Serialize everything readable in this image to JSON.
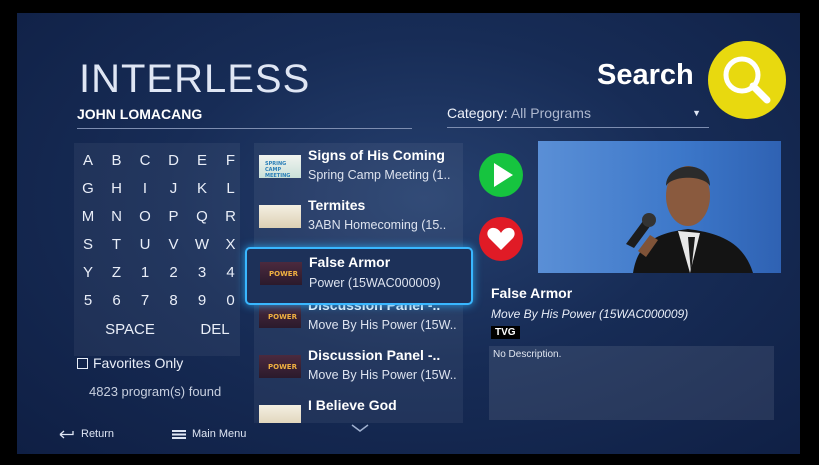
{
  "app": {
    "title": "INTERLESS"
  },
  "search": {
    "query": "JOHN LOMACANG",
    "label": "Search"
  },
  "category": {
    "label": "Category:",
    "value": "All Programs"
  },
  "keypad": {
    "rows": [
      [
        "A",
        "B",
        "C",
        "D",
        "E",
        "F"
      ],
      [
        "G",
        "H",
        "I",
        "J",
        "K",
        "L"
      ],
      [
        "M",
        "N",
        "O",
        "P",
        "Q",
        "R"
      ],
      [
        "S",
        "T",
        "U",
        "V",
        "W",
        "X"
      ],
      [
        "Y",
        "Z",
        "1",
        "2",
        "3",
        "4"
      ],
      [
        "5",
        "6",
        "7",
        "8",
        "9",
        "0"
      ]
    ],
    "space": "SPACE",
    "del": "DEL"
  },
  "filters": {
    "favorites_label": "Favorites Only",
    "found": "4823 program(s) found"
  },
  "results": [
    {
      "title": "Signs of His Coming",
      "subtitle": "Spring Camp Meeting (1..",
      "thumb": "spring-camp-meeting"
    },
    {
      "title": "Termites",
      "subtitle": "3ABN Homecoming (15..",
      "thumb": "3abn-homecoming"
    },
    {
      "title": "False Armor",
      "subtitle": "Power (15WAC000009)",
      "thumb": "move-by-his-power"
    },
    {
      "title": "Discussion Panel -..",
      "subtitle": "Move By His Power (15W..",
      "thumb": "move-by-his-power"
    },
    {
      "title": "Discussion Panel -..",
      "subtitle": "Move By His Power (15W..",
      "thumb": "move-by-his-power"
    },
    {
      "title": "I Believe God",
      "subtitle": "",
      "thumb": "3abn-homecoming"
    }
  ],
  "thumb_texts": {
    "spring": "SPRING CAMP MEETING",
    "power": "POWER"
  },
  "detail": {
    "title": "False Armor",
    "subtitle": "Move By His Power (15WAC000009)",
    "rating": "TVG",
    "description": "No Description."
  },
  "footer": {
    "return_label": "Return",
    "menu_label": "Main Menu"
  },
  "colors": {
    "accent_search": "#e8d90f",
    "play": "#16c43f",
    "favorite": "#e01b26",
    "focus": "#39b7ff"
  }
}
